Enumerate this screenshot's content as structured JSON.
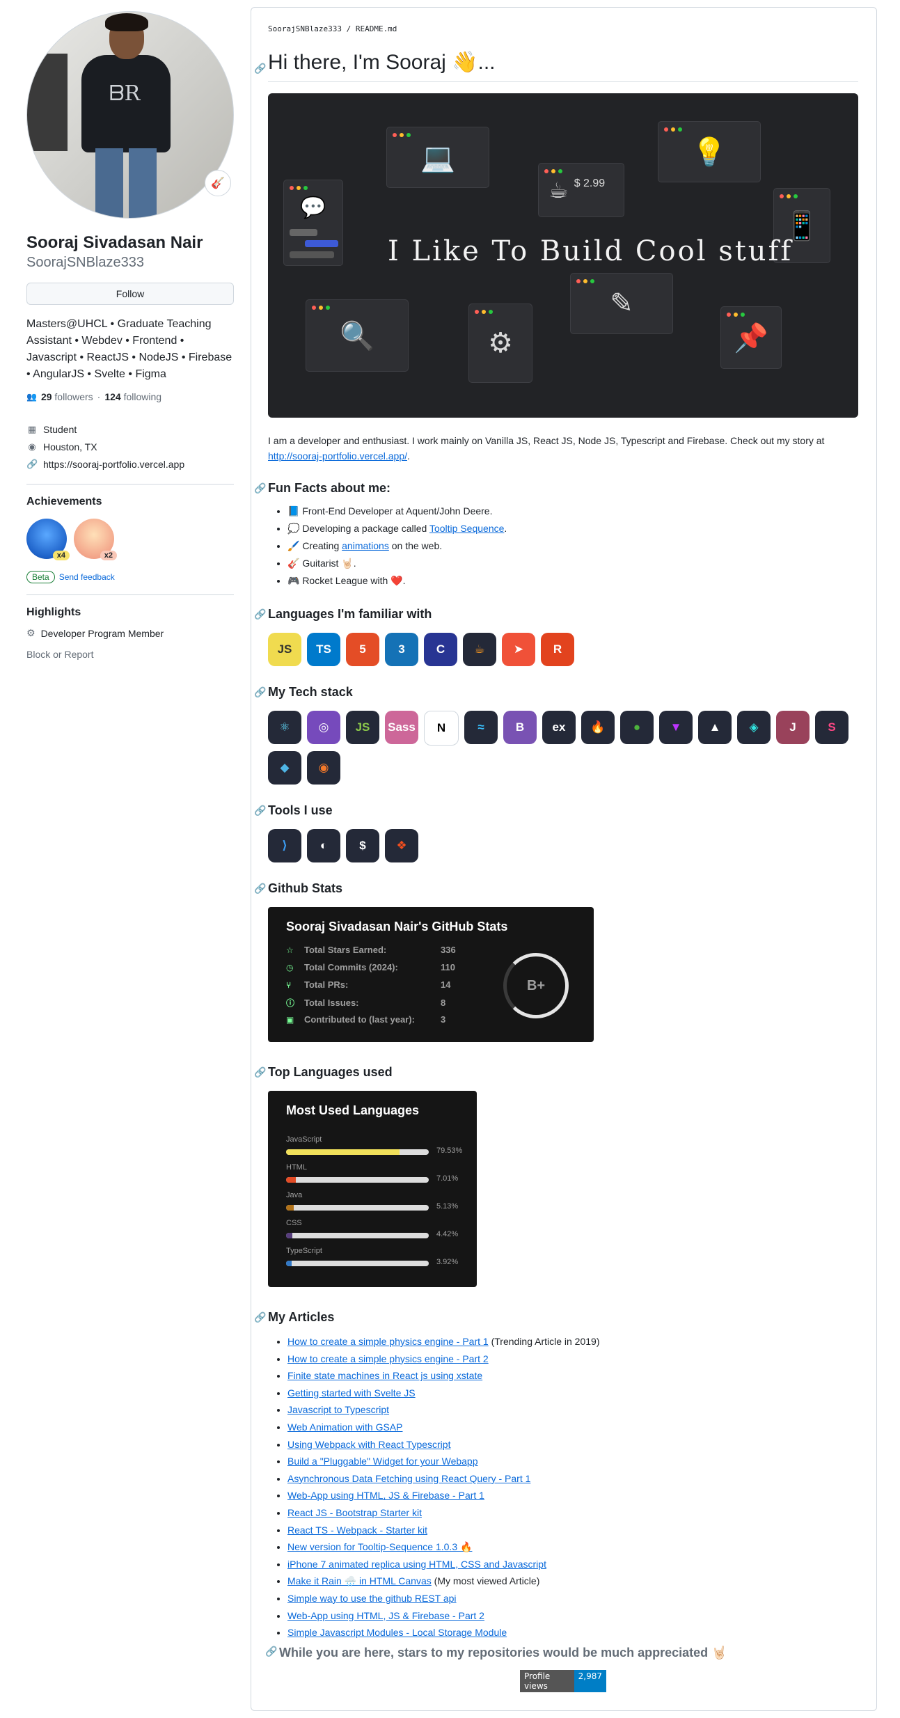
{
  "profile": {
    "fullname": "Sooraj Sivadasan Nair",
    "username": "SoorajSNBlaze333",
    "follow_label": "Follow",
    "bio": "Masters@UHCL • Graduate Teaching Assistant • Webdev • Frontend • Javascript • ReactJS • NodeJS • Firebase • AngularJS • Svelte • Figma",
    "followers": "29",
    "followers_label": "followers",
    "following": "124",
    "following_label": "following",
    "dot": "·",
    "company": "Student",
    "location": "Houston, TX",
    "website": "https://sooraj-portfolio.vercel.app",
    "achievements_title": "Achievements",
    "badge1_count": "x4",
    "badge2_count": "x2",
    "beta_label": "Beta",
    "feedback_label": "Send feedback",
    "highlights_title": "Highlights",
    "highlight_item": "Developer Program Member",
    "block_label": "Block or Report"
  },
  "readme": {
    "path": "SoorajSNBlaze333 / README.md",
    "title": "Hi there, I'm Sooraj 👋...",
    "banner_text": "I Like To Build Cool stuff",
    "banner_price": "$ 2.99",
    "intro": "I am a developer and enthusiast. I work mainly on Vanilla JS, React JS, Node JS, Typescript and Firebase. Check out my story at ",
    "intro_link": "http://sooraj-portfolio.vercel.app/",
    "intro_end": ".",
    "fun_title": "Fun Facts about me:",
    "fun1": "📘 Front-End Developer at Aquent/John Deere.",
    "fun2_pre": "💭 Developing a package called ",
    "fun2_link": "Tooltip Sequence",
    "fun2_post": ".",
    "fun3_pre": "🖌️ Creating ",
    "fun3_link": "animations",
    "fun3_post": " on the web.",
    "fun4": "🎸 Guitarist 🤘🏻.",
    "fun5": "🎮 Rocket League with ❤️.",
    "languages_title": "Languages I'm familiar with",
    "techstack_title": "My Tech stack",
    "tools_title": "Tools I use",
    "stats_title": "Github Stats",
    "toplang_title": "Top Languages used",
    "articles_title": "My Articles",
    "final_text": "While you are here, stars to my repositories would be much appreciated 🤘🏻",
    "views_label": "Profile views",
    "views_count": "2,987"
  },
  "language_icons": [
    {
      "name": "javascript-icon",
      "label": "JS",
      "bg": "#f0db4f",
      "fg": "#323330"
    },
    {
      "name": "typescript-icon",
      "label": "TS",
      "bg": "#007acc",
      "fg": "#ffffff"
    },
    {
      "name": "html5-icon",
      "label": "5",
      "bg": "#e44d26",
      "fg": "#ffffff"
    },
    {
      "name": "css3-icon",
      "label": "3",
      "bg": "#1572b6",
      "fg": "#ffffff"
    },
    {
      "name": "c-icon",
      "label": "C",
      "bg": "#283593",
      "fg": "#ffffff"
    },
    {
      "name": "java-icon",
      "label": "☕",
      "bg": "#242938",
      "fg": "#f89820"
    },
    {
      "name": "swift-icon",
      "label": "➤",
      "bg": "#f05138",
      "fg": "#ffffff"
    },
    {
      "name": "rust-icon",
      "label": "R",
      "bg": "#e2431e",
      "fg": "#ffffff"
    }
  ],
  "tech_icons": [
    {
      "name": "react-icon",
      "label": "⚛",
      "bg": "#242938",
      "fg": "#61dafb"
    },
    {
      "name": "redux-icon",
      "label": "◎",
      "bg": "#764abc",
      "fg": "#ffffff"
    },
    {
      "name": "nodejs-icon",
      "label": "JS",
      "bg": "#242938",
      "fg": "#8cc84b"
    },
    {
      "name": "sass-icon",
      "label": "Sass",
      "bg": "#cd6799",
      "fg": "#ffffff"
    },
    {
      "name": "nextjs-icon",
      "label": "N",
      "bg": "#ffffff",
      "fg": "#000000"
    },
    {
      "name": "tailwind-icon",
      "label": "≈",
      "bg": "#242938",
      "fg": "#38bdf8"
    },
    {
      "name": "bootstrap-icon",
      "label": "B",
      "bg": "#7952b3",
      "fg": "#ffffff"
    },
    {
      "name": "express-icon",
      "label": "ex",
      "bg": "#242938",
      "fg": "#ffffff"
    },
    {
      "name": "firebase-icon",
      "label": "🔥",
      "bg": "#242938",
      "fg": "#ffca28"
    },
    {
      "name": "mongodb-icon",
      "label": "●",
      "bg": "#242938",
      "fg": "#4db33d"
    },
    {
      "name": "vite-icon",
      "label": "▼",
      "bg": "#242938",
      "fg": "#bd34fe"
    },
    {
      "name": "vercel-icon",
      "label": "▲",
      "bg": "#242938",
      "fg": "#ffffff"
    },
    {
      "name": "netlify-icon",
      "label": "◈",
      "bg": "#242938",
      "fg": "#32e6e2"
    },
    {
      "name": "jest-icon",
      "label": "J",
      "bg": "#99425b",
      "fg": "#ffffff"
    },
    {
      "name": "storybook-icon",
      "label": "S",
      "bg": "#242938",
      "fg": "#ff4785"
    },
    {
      "name": "threejs-icon",
      "label": "◆",
      "bg": "#242938",
      "fg": "#4fb5e5"
    },
    {
      "name": "blender-icon",
      "label": "◉",
      "bg": "#242938",
      "fg": "#f5792a"
    }
  ],
  "tool_icons": [
    {
      "name": "vscode-icon",
      "label": "⟩",
      "bg": "#242938",
      "fg": "#3b9cf2"
    },
    {
      "name": "github-icon",
      "label": "◐",
      "bg": "#242938",
      "fg": "#ffffff"
    },
    {
      "name": "bash-icon",
      "label": "$",
      "bg": "#242938",
      "fg": "#ffffff"
    },
    {
      "name": "figma-icon",
      "label": "❖",
      "bg": "#242938",
      "fg": "#f24e1e"
    }
  ],
  "stats": {
    "title": "Sooraj Sivadasan Nair's GitHub Stats",
    "rows": [
      {
        "icon": "☆",
        "label": "Total Stars Earned:",
        "value": "336"
      },
      {
        "icon": "◷",
        "label": "Total Commits (2024):",
        "value": "110"
      },
      {
        "icon": "⑂",
        "label": "Total PRs:",
        "value": "14"
      },
      {
        "icon": "ⓘ",
        "label": "Total Issues:",
        "value": "8"
      },
      {
        "icon": "▣",
        "label": "Contributed to (last year):",
        "value": "3"
      }
    ],
    "grade": "B+"
  },
  "top_languages": {
    "title": "Most Used Languages",
    "langs": [
      {
        "name": "JavaScript",
        "pct": "79.53%",
        "value": 79.53,
        "color": "#f1e05a"
      },
      {
        "name": "HTML",
        "pct": "7.01%",
        "value": 7.01,
        "color": "#e34c26"
      },
      {
        "name": "Java",
        "pct": "5.13%",
        "value": 5.13,
        "color": "#b07219"
      },
      {
        "name": "CSS",
        "pct": "4.42%",
        "value": 4.42,
        "color": "#563d7c"
      },
      {
        "name": "TypeScript",
        "pct": "3.92%",
        "value": 3.92,
        "color": "#3178c6"
      }
    ]
  },
  "articles": [
    {
      "title": "How to create a simple physics engine - Part 1",
      "note": " (Trending Article in 2019)"
    },
    {
      "title": "How to create a simple physics engine - Part 2",
      "note": ""
    },
    {
      "title": "Finite state machines in React js using xstate",
      "note": ""
    },
    {
      "title": "Getting started with Svelte JS",
      "note": ""
    },
    {
      "title": "Javascript to Typescript",
      "note": ""
    },
    {
      "title": "Web Animation with GSAP",
      "note": ""
    },
    {
      "title": "Using Webpack with React Typescript",
      "note": ""
    },
    {
      "title": "Build a \"Pluggable\" Widget for your Webapp",
      "note": ""
    },
    {
      "title": "Asynchronous Data Fetching using React Query - Part 1",
      "note": ""
    },
    {
      "title": "Web-App using HTML, JS & Firebase - Part 1",
      "note": ""
    },
    {
      "title": "React JS - Bootstrap Starter kit",
      "note": ""
    },
    {
      "title": "React TS - Webpack - Starter kit",
      "note": ""
    },
    {
      "title": "New version for Tooltip-Sequence 1.0.3 🔥",
      "note": ""
    },
    {
      "title": "iPhone 7 animated replica using HTML, CSS and Javascript",
      "note": ""
    },
    {
      "title": "Make it Rain 🌧️ in HTML Canvas",
      "note": " (My most viewed Article)"
    },
    {
      "title": "Simple way to use the github REST api",
      "note": ""
    },
    {
      "title": "Web-App using HTML, JS & Firebase - Part 2",
      "note": ""
    },
    {
      "title": "Simple Javascript Modules - Local Storage Module",
      "note": ""
    }
  ]
}
